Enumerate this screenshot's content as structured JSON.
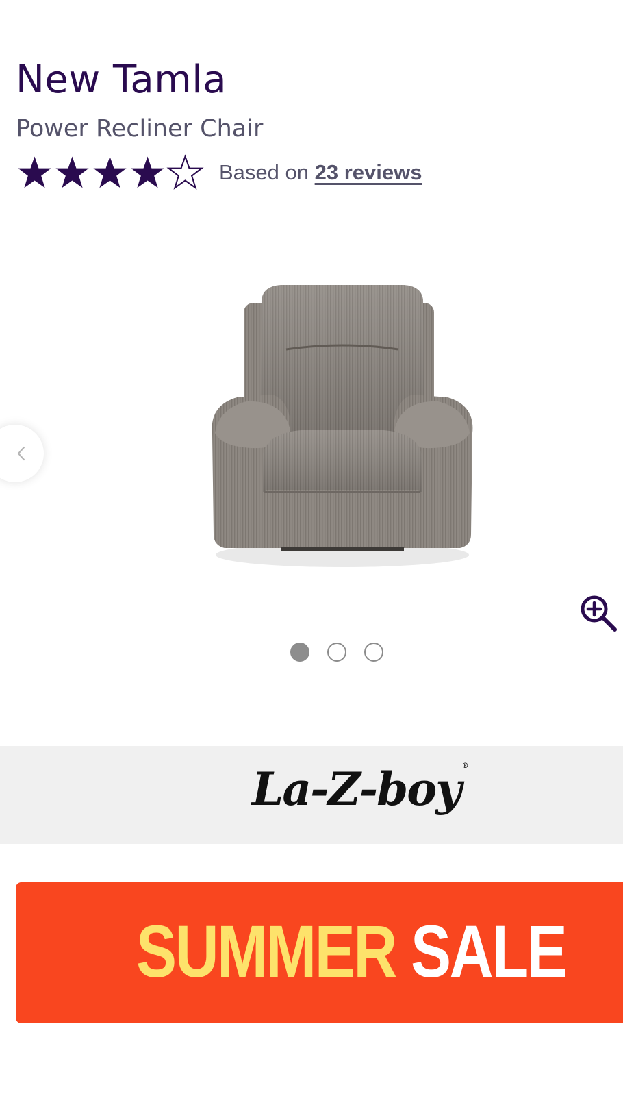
{
  "product": {
    "title": "New Tamla",
    "subtitle": "Power Recliner Chair",
    "rating": {
      "value": 4,
      "max": 5
    },
    "reviews_prefix": "Based on",
    "reviews_link": "23 reviews"
  },
  "gallery": {
    "image_alt": "grey fabric power recliner chair",
    "slide_count": 3,
    "active_slide": 1,
    "prev_icon": "chevron-left-icon",
    "zoom_icon": "zoom-in-icon"
  },
  "brand": {
    "logo_text": "La-Z-boy",
    "logo_reg": "®"
  },
  "banner": {
    "word_1": "SUMMER",
    "word_2": "SALE"
  },
  "colors": {
    "accent": "#2a0b4f",
    "banner_bg": "#f9461f",
    "banner_highlight": "#fde26b",
    "brand_band": "#f0f0f0"
  }
}
